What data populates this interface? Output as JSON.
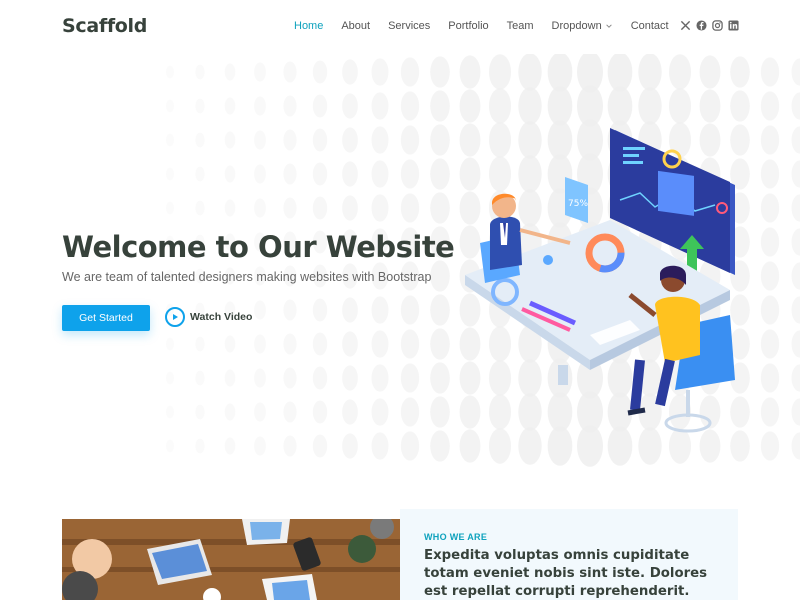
{
  "header": {
    "logo": "Scaffold",
    "nav": [
      {
        "label": "Home",
        "active": true
      },
      {
        "label": "About",
        "active": false
      },
      {
        "label": "Services",
        "active": false
      },
      {
        "label": "Portfolio",
        "active": false
      },
      {
        "label": "Team",
        "active": false
      },
      {
        "label": "Dropdown",
        "active": false
      },
      {
        "label": "Contact",
        "active": false
      }
    ],
    "socials": [
      "x-icon",
      "facebook-icon",
      "instagram-icon",
      "linkedin-icon"
    ]
  },
  "hero": {
    "title": "Welcome to Our Website",
    "subtitle": "We are team of talented designers making websites with Bootstrap",
    "cta_label": "Get Started",
    "watch_label": "Watch Video",
    "tablet_label": "75%"
  },
  "about": {
    "kicker": "WHO WE ARE",
    "text": "Expedita voluptas omnis cupiditate totam eveniet nobis sint iste. Dolores est repellat corrupti reprehenderit."
  },
  "colors": {
    "accent": "#0ea2bd",
    "button": "#0ea2eb",
    "heading": "#37423b"
  }
}
